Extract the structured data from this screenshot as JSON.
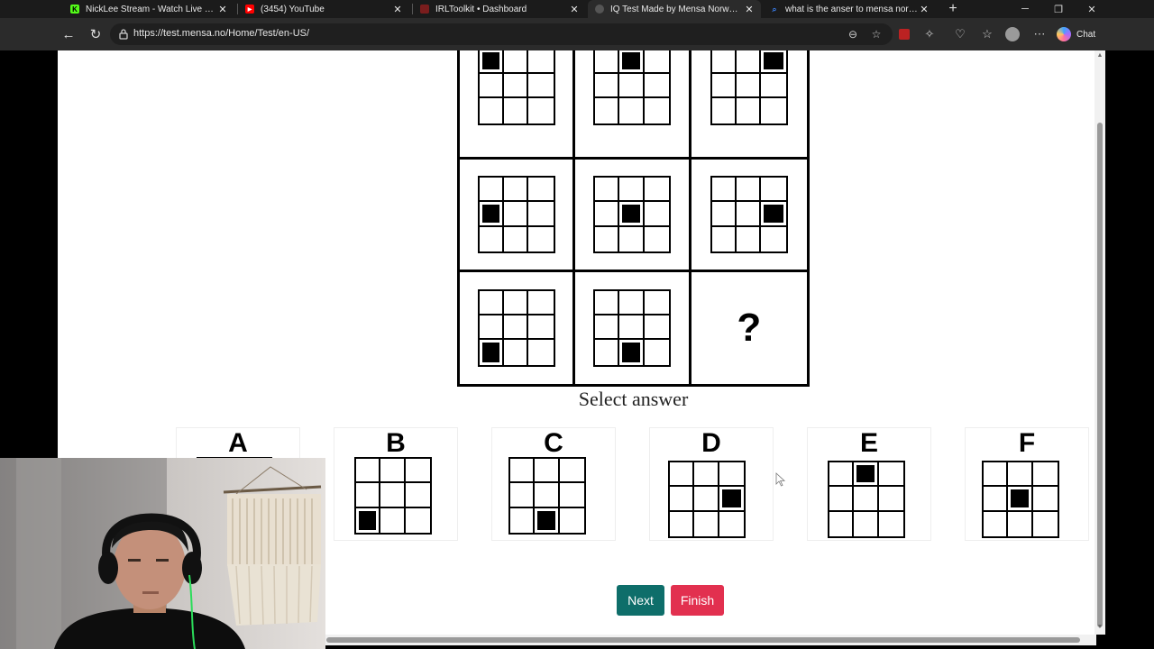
{
  "browser": {
    "tabs": [
      {
        "title": "NickLee Stream - Watch Live on Kick",
        "favicon_color": "#53fc18",
        "favicon_char": "K",
        "active": false
      },
      {
        "title": "(3454) YouTube",
        "favicon_color": "#ff0000",
        "favicon_char": "▶",
        "active": false
      },
      {
        "title": "IRLToolkit • Dashboard",
        "favicon_color": "#c0392b",
        "favicon_char": "",
        "active": false
      },
      {
        "title": "IQ Test Made by Mensa Norway - IQ",
        "favicon_color": "#9a9a9a",
        "favicon_char": "",
        "active": true
      },
      {
        "title": "what is the anser to mensa norway",
        "favicon_color": "#3b82f6",
        "favicon_char": "🔍",
        "active": false
      }
    ],
    "close_glyph": "✕",
    "new_tab_glyph": "+",
    "url": "https://test.mensa.no/Home/Test/en-US/",
    "chat_label": "Chat"
  },
  "puzzle": {
    "matrix": [
      {
        "filled": 0
      },
      {
        "filled": 1
      },
      {
        "filled": 2
      },
      {
        "filled": 3
      },
      {
        "filled": 4
      },
      {
        "filled": 5
      },
      {
        "filled": 6
      },
      {
        "filled": 7
      },
      {
        "filled": null,
        "mark": "?"
      }
    ],
    "prompt": "Select answer"
  },
  "answers": [
    {
      "letter": "A",
      "filled": null
    },
    {
      "letter": "B",
      "filled": 6
    },
    {
      "letter": "C",
      "filled": 7
    },
    {
      "letter": "D",
      "filled": 5
    },
    {
      "letter": "E",
      "filled": 1
    },
    {
      "letter": "F",
      "filled": 4
    }
  ],
  "buttons": {
    "next": "Next",
    "finish": "Finish"
  },
  "colors": {
    "next": "#0e6e6a",
    "finish": "#e2304f"
  }
}
